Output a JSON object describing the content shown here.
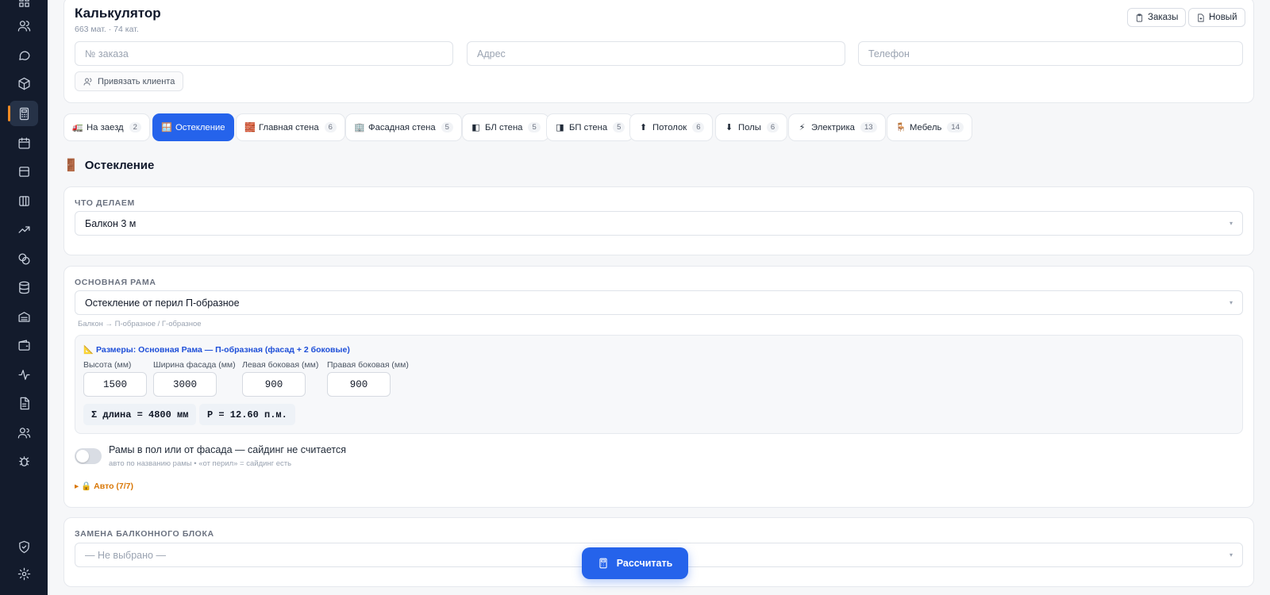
{
  "sidebar": {
    "icons": [
      "grid-icon",
      "users-icon",
      "chat-icon",
      "cube-icon",
      "calculator-icon",
      "calendar-icon",
      "layout-icon",
      "columns-icon",
      "trend-icon",
      "coins-icon",
      "database-icon",
      "archive-icon",
      "wallet-icon",
      "activity-icon",
      "document-icon",
      "team-icon",
      "bug-icon",
      "shield-icon",
      "settings-icon"
    ],
    "active": "calculator-icon"
  },
  "header": {
    "title": "Калькулятор",
    "subtitle": "663 мат. · 74 кат.",
    "orders_label": "Заказы",
    "new_label": "Новый",
    "order_placeholder": "№ заказа",
    "address_placeholder": "Адрес",
    "phone_placeholder": "Телефон",
    "bind_client_label": "Привязать клиента"
  },
  "tabs": [
    {
      "emoji": "🚛",
      "label": "На заезд",
      "count": "2"
    },
    {
      "emoji": "🪟",
      "label": "Остекление",
      "count": ""
    },
    {
      "emoji": "🧱",
      "label": "Главная стена",
      "count": "6"
    },
    {
      "emoji": "🏢",
      "label": "Фасадная стена",
      "count": "5"
    },
    {
      "emoji": "◧",
      "label": "БЛ стена",
      "count": "5"
    },
    {
      "emoji": "◨",
      "label": "БП стена",
      "count": "5"
    },
    {
      "emoji": "⬆",
      "label": "Потолок",
      "count": "6"
    },
    {
      "emoji": "⬇",
      "label": "Полы",
      "count": "6"
    },
    {
      "emoji": "⚡",
      "label": "Электрика",
      "count": "13"
    },
    {
      "emoji": "🪑",
      "label": "Мебель",
      "count": "14"
    }
  ],
  "section": {
    "emoji": "🚪",
    "title": "Остекление"
  },
  "what": {
    "label": "ЧТО ДЕЛАЕМ",
    "value": "Балкон 3 м"
  },
  "frame": {
    "label": "ОСНОВНАЯ РАМА",
    "value": "Остекление от перил П-образное",
    "hint": "Балкон → П-образное / Г-образное",
    "dims_title": "📐 Размеры: Основная Рама — П-образная (фасад + 2 боковые)",
    "height_label": "Высота (мм)",
    "height_value": "1500",
    "facade_label": "Ширина фасада (мм)",
    "facade_value": "3000",
    "left_label": "Левая боковая (мм)",
    "left_value": "900",
    "right_label": "Правая боковая (мм)",
    "right_value": "900",
    "sum_text": "Σ длина = 4800 мм",
    "p_text": "P = 12.60 п.м.",
    "toggle_label": "Рамы в пол или от фасада — сайдинг не считается",
    "toggle_hint": "авто по названию рамы • «от перил» = сайдинг есть",
    "toggle_on": false,
    "auto_label": "▸ 🔒 Авто (7/7)"
  },
  "replace": {
    "label": "ЗАМЕНА БАЛКОННОГО БЛОКА",
    "value": "— Не выбрано —"
  },
  "fab_label": "Рассчитать",
  "colors": {
    "accent": "#2563eb",
    "sidebar": "#131b2c",
    "active_marker": "#f08a24",
    "auto": "#d97706"
  }
}
